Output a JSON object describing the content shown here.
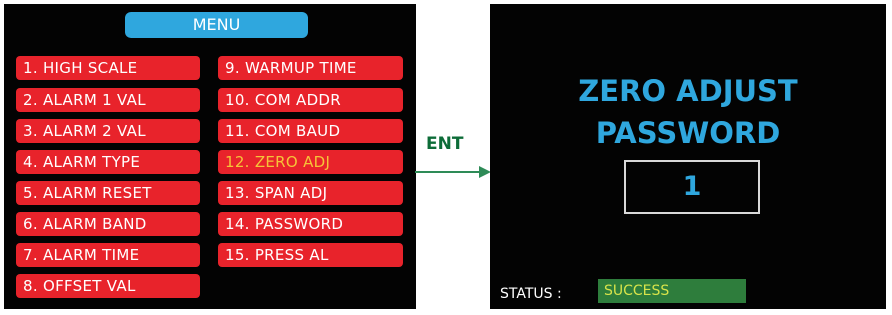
{
  "menu": {
    "title": "MENU",
    "left_items": [
      "1. HIGH  SCALE",
      "2. ALARM 1 VAL",
      "3. ALARM 2 VAL",
      "4. ALARM TYPE",
      "5. ALARM RESET",
      "6. ALARM BAND",
      "7. ALARM TIME",
      "8. OFFSET VAL"
    ],
    "right_items": [
      "9. WARMUP TIME",
      "10. COM ADDR",
      "11. COM BAUD",
      "12. ZERO ADJ",
      "13. SPAN ADJ",
      "14. PASSWORD",
      "15. PRESS AL"
    ],
    "selected_item": "12. ZERO ADJ"
  },
  "transition": {
    "label": "ENT"
  },
  "zero_adjust": {
    "title_line1": "ZERO ADJUST",
    "title_line2": "PASSWORD",
    "password_value": "1",
    "status_label": "STATUS :",
    "status_value": "SUCCESS"
  },
  "colors": {
    "screen_bg": "#030303",
    "menu_item_bg": "#e8232b",
    "menu_title_bg": "#2fa7de",
    "selected_text": "#f6c338",
    "title_text": "#2fa7de",
    "status_bg": "#2e7d3c",
    "status_text": "#d7e34a",
    "arrow": "#2e8b57"
  }
}
